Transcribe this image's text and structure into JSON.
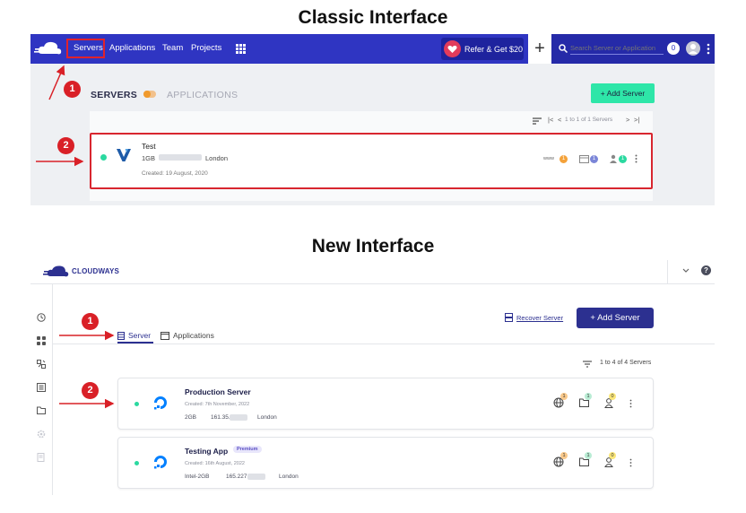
{
  "headings": {
    "classic": "Classic Interface",
    "new": "New Interface"
  },
  "markers": {
    "one": "1",
    "two": "2"
  },
  "classic": {
    "nav": {
      "items": [
        "Servers",
        "Applications",
        "Team",
        "Projects"
      ],
      "refer_label": "Refer & Get $20",
      "plus": "+",
      "search_placeholder": "Search Server or Application",
      "notif_count": "0"
    },
    "toolbar": {
      "servers_label": "SERVERS",
      "applications_label": "APPLICATIONS",
      "add_server_label": "+ Add Server"
    },
    "pagination": {
      "first": "|<",
      "prev": "<",
      "info": "1 to 1 of 1 Servers",
      "next": ">",
      "last": ">|"
    },
    "server": {
      "name": "Test",
      "size": "1GB",
      "location": "London",
      "created": "Created: 19 August, 2020",
      "www_label": "www",
      "badges": [
        "1",
        "1",
        "1"
      ]
    }
  },
  "new": {
    "brand": "CLOUDWAYS",
    "help": "?",
    "recover_label": "Recover Server",
    "add_server_label": "+ Add Server",
    "tabs": {
      "server": "Server",
      "applications": "Applications"
    },
    "count_label": "1 to 4 of 4 Servers",
    "servers": [
      {
        "name": "Production Server",
        "created": "Created: 7th November, 2022",
        "size": "2GB",
        "ip": "161.35.",
        "location": "London",
        "badges": [
          "1",
          "1",
          "0"
        ]
      },
      {
        "name": "Testing App",
        "tag": "Premium",
        "created": "Created: 16th August, 2022",
        "size": "Intel-2GB",
        "ip": "165.227.",
        "location": "London",
        "badges": [
          "1",
          "1",
          "0"
        ]
      }
    ]
  },
  "colors": {
    "classic_nav": "#2f35c2",
    "new_primary": "#2c3090",
    "add_server_green": "#2ee6a8",
    "annotation_red": "#d92027",
    "status_green": "#2bd9a0"
  }
}
